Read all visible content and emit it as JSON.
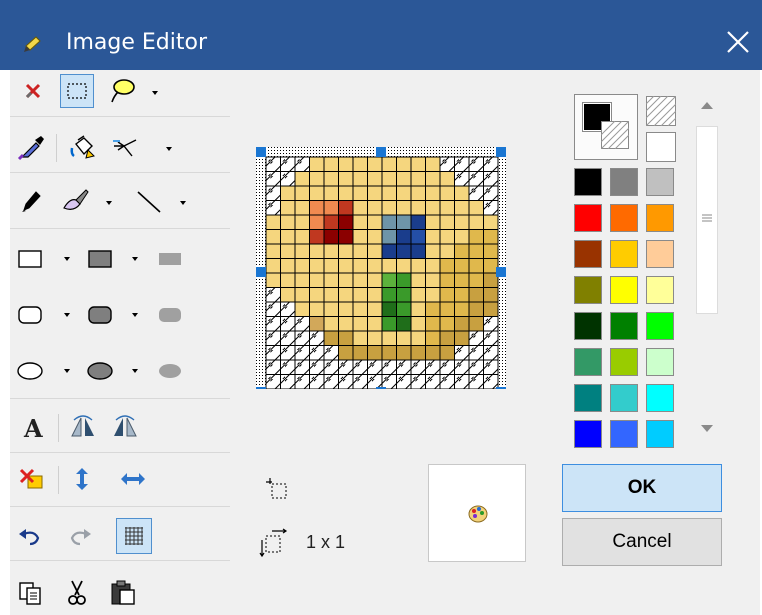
{
  "window": {
    "title": "Image Editor",
    "close_glyph": "✕"
  },
  "toolbar": {
    "rows": [
      [
        "clear-icon",
        "rectangle-select-icon",
        "lasso-select-icon"
      ],
      [
        "eyedropper-icon",
        "paint-bucket-icon",
        "color-replace-icon"
      ],
      [
        "pencil-icon",
        "brush-icon",
        "line-icon"
      ],
      [
        "rectangle-outline-icon",
        "rectangle-filled-icon",
        "rectangle-solid-icon"
      ],
      [
        "rounded-rect-outline-icon",
        "rounded-rect-filled-icon",
        "rounded-rect-solid-icon"
      ],
      [
        "ellipse-outline-icon",
        "ellipse-filled-icon",
        "ellipse-solid-icon"
      ],
      [
        "text-icon",
        "flip-horizontal-icon",
        "flip-vertical-icon"
      ],
      [
        "delete-icon",
        "resize-vertical-icon",
        "resize-horizontal-icon"
      ],
      [
        "undo-icon",
        "redo-icon",
        "grid-icon"
      ],
      [
        "copy-icon",
        "cut-icon",
        "paste-icon"
      ]
    ],
    "text_tool_glyph": "A"
  },
  "canvas": {
    "grid_size": 16,
    "palette": {
      "T": "checker",
      "Y": "#f5d67e",
      "y": "#f7e3a0",
      "G": "#e0b84c",
      "B": "#c8a040",
      "D": "#d2a85a",
      "O": "#f08a50",
      "R": "#8b0000",
      "r": "#c03820",
      "S": "#6e95a8",
      "N": "#1a3d8c",
      "n": "#244fa6",
      "L": "#3a9a2a",
      "l": "#5cb23c",
      "K": "#1f6e1a"
    },
    "pixels": [
      "TTTYYYYYYYYYTTTT",
      "TTYYYYYYYYYYYTTT",
      "TYYYYYYYYYYYYYTT",
      "TYYOOrYYYYYYYYYT",
      "YYYOrRYYSSNYYYYY",
      "YYYrRRYYSNnYYYGG",
      "YYYYYYYYNNNYYGGG",
      "YYYYYYYYYYYYGGGG",
      "YYYYYYYYlLYYGGGB",
      "TYYYYYYYLLYYGGBB",
      "TTYYYYYYKLYGGGBB",
      "TTTDYYYYLKYGGBBT",
      "TTTTBBYYYYYGBBTT",
      "TTTTTBBBBBBBBTTT",
      "TTTTTTTTTTTTTTTT",
      "TTTTTTTTTTTTTTTT"
    ]
  },
  "size_info": {
    "label": "1 x 1"
  },
  "preview": {
    "icon": "palette-icon"
  },
  "buttons": {
    "ok": "OK",
    "cancel": "Cancel"
  },
  "colors": {
    "current_foreground": "#000000",
    "current_background": "#ffffff",
    "swatches": [
      [
        "#000000",
        "#808080",
        "#c0c0c0"
      ],
      [
        "#ff0000",
        "#ff6a00",
        "#ff9900"
      ],
      [
        "#993300",
        "#ffcc00",
        "#ffcc99"
      ],
      [
        "#808000",
        "#ffff00",
        "#ffff99"
      ],
      [
        "#003300",
        "#008000",
        "#00ff00"
      ],
      [
        "#339966",
        "#99cc00",
        "#ccffcc"
      ],
      [
        "#008080",
        "#33cccc",
        "#00ffff"
      ],
      [
        "#0000ff",
        "#3366ff",
        "#00ccff"
      ]
    ]
  }
}
